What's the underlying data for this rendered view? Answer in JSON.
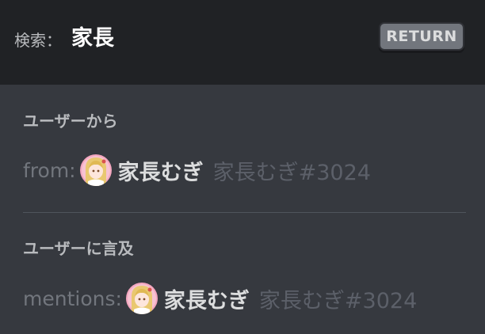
{
  "header": {
    "search_label": "検索：",
    "query": "家長",
    "return_label": "RETURN"
  },
  "sections": [
    {
      "title": "ユーザーから",
      "prefix": "from:",
      "user": {
        "display_name": "家長むぎ",
        "tag": "家長むぎ#3024"
      }
    },
    {
      "title": "ユーザーに言及",
      "prefix": "mentions:",
      "user": {
        "display_name": "家長むぎ",
        "tag": "家長むぎ#3024"
      }
    }
  ],
  "colors": {
    "header_bg": "#202225",
    "panel_bg": "#36393f",
    "return_button": "#72767d"
  }
}
